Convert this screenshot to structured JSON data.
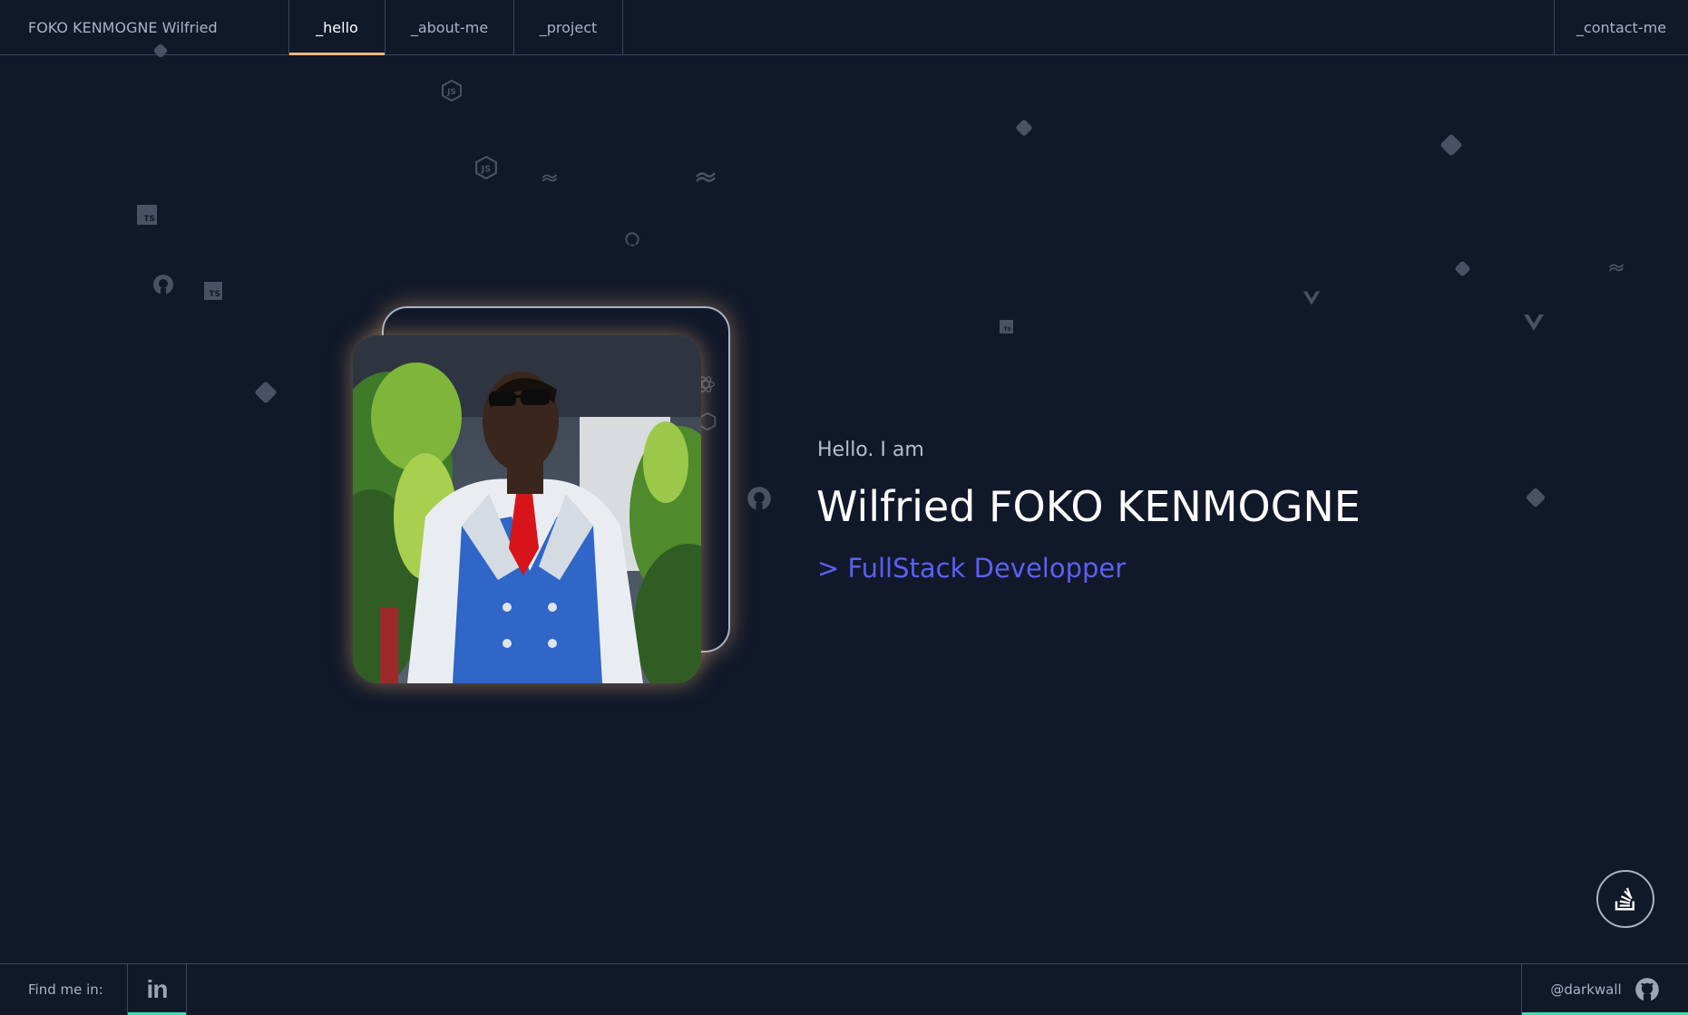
{
  "header": {
    "brand": "FOKO KENMOGNE Wilfried",
    "tabs": [
      {
        "label": "_hello",
        "active": true
      },
      {
        "label": "_about-me",
        "active": false
      },
      {
        "label": "_project",
        "active": false
      }
    ],
    "contact": "_contact-me"
  },
  "hero": {
    "greeting": "Hello. I am",
    "name": "Wilfried FOKO KENMOGNE",
    "role": "> FullStack Developper",
    "photo_alt": "portrait photo"
  },
  "footer": {
    "find_me": "Find me in:",
    "linkedin_label": "in",
    "github_handle": "@darkwall"
  },
  "colors": {
    "background": "#111829",
    "accent_tab": "#f3b775",
    "accent_footer": "#43d9ad",
    "role_text": "#5c5ff6",
    "floating_icons": "#4a5164"
  },
  "floating_icons": [
    "nodejs-icon",
    "tailwind-icon",
    "github-icon",
    "typescript-icon",
    "git-icon",
    "vue-icon",
    "react-icon"
  ],
  "stackoverflow_icon": "stackoverflow-icon"
}
